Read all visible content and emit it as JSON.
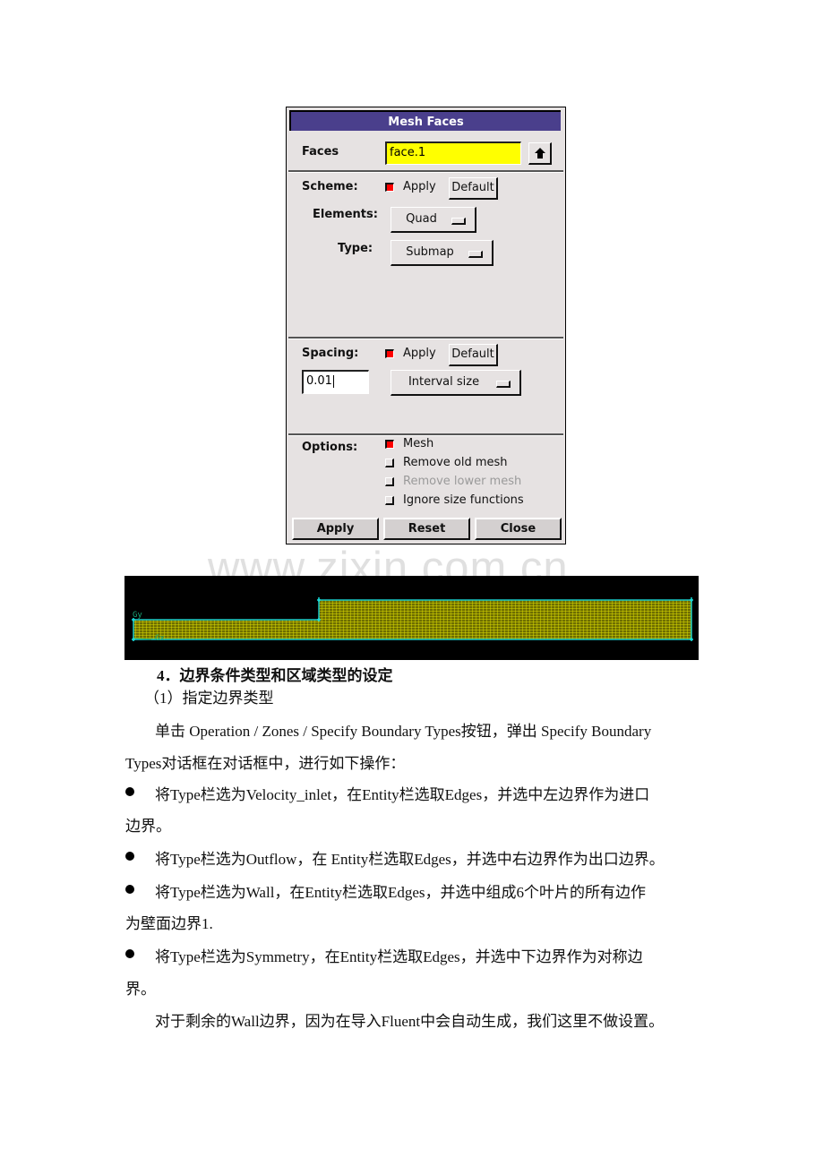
{
  "dialog": {
    "title": "Mesh Faces",
    "faces": {
      "label": "Faces",
      "value": "face.1",
      "pick_icon": "up-arrow-icon"
    },
    "scheme": {
      "label": "Scheme:",
      "apply_label": "Apply",
      "apply_checked": true,
      "default_label": "Default",
      "elements_label": "Elements:",
      "elements_value": "Quad",
      "type_label": "Type:",
      "type_value": "Submap"
    },
    "spacing": {
      "label": "Spacing:",
      "apply_label": "Apply",
      "apply_checked": true,
      "default_label": "Default",
      "value": "0.01",
      "mode_value": "Interval size"
    },
    "options": {
      "label": "Options:",
      "items": [
        {
          "label": "Mesh",
          "checked": true,
          "enabled": true
        },
        {
          "label": "Remove old mesh",
          "checked": false,
          "enabled": true
        },
        {
          "label": "Remove lower mesh",
          "checked": false,
          "enabled": false
        },
        {
          "label": "Ignore size functions",
          "checked": false,
          "enabled": true
        }
      ]
    },
    "buttons": {
      "apply": "Apply",
      "reset": "Reset",
      "close": "Close"
    }
  },
  "watermark": "www.zixin.com.cn",
  "mesh_view": {
    "axis_y_label": "Gy",
    "axis_x_label": "Gx",
    "colors": {
      "background": "#000000",
      "mesh": "#c8c800",
      "edge": "#19c8c8",
      "axis": "#19a878"
    }
  },
  "document": {
    "heading": "4．边界条件类型和区域类型的设定",
    "subheading": "（1）指定边界类型",
    "intro_line1": "单击  Operation / Zones / Specify Boundary Types按钮，弹出  Specify Boundary",
    "intro_line2": "Types对话框在对话框中，进行如下操作：",
    "bullets": [
      {
        "line1": "将Type栏选为Velocity_inlet，在Entity栏选取Edges，并选中左边界作为进口",
        "line2": "边界。"
      },
      {
        "line1": "将Type栏选为Outflow，在  Entity栏选取Edges，并选中右边界作为出口边界。",
        "line2": ""
      },
      {
        "line1": "将Type栏选为Wall，在Entity栏选取Edges，并选中组成6个叶片的所有边作",
        "line2": "为壁面边界1."
      },
      {
        "line1": "将Type栏选为Symmetry，在Entity栏选取Edges，并选中下边界作为对称边",
        "line2": "界。"
      }
    ],
    "closing": "对于剩余的Wall边界，因为在导入Fluent中会自动生成，我们这里不做设置。"
  }
}
